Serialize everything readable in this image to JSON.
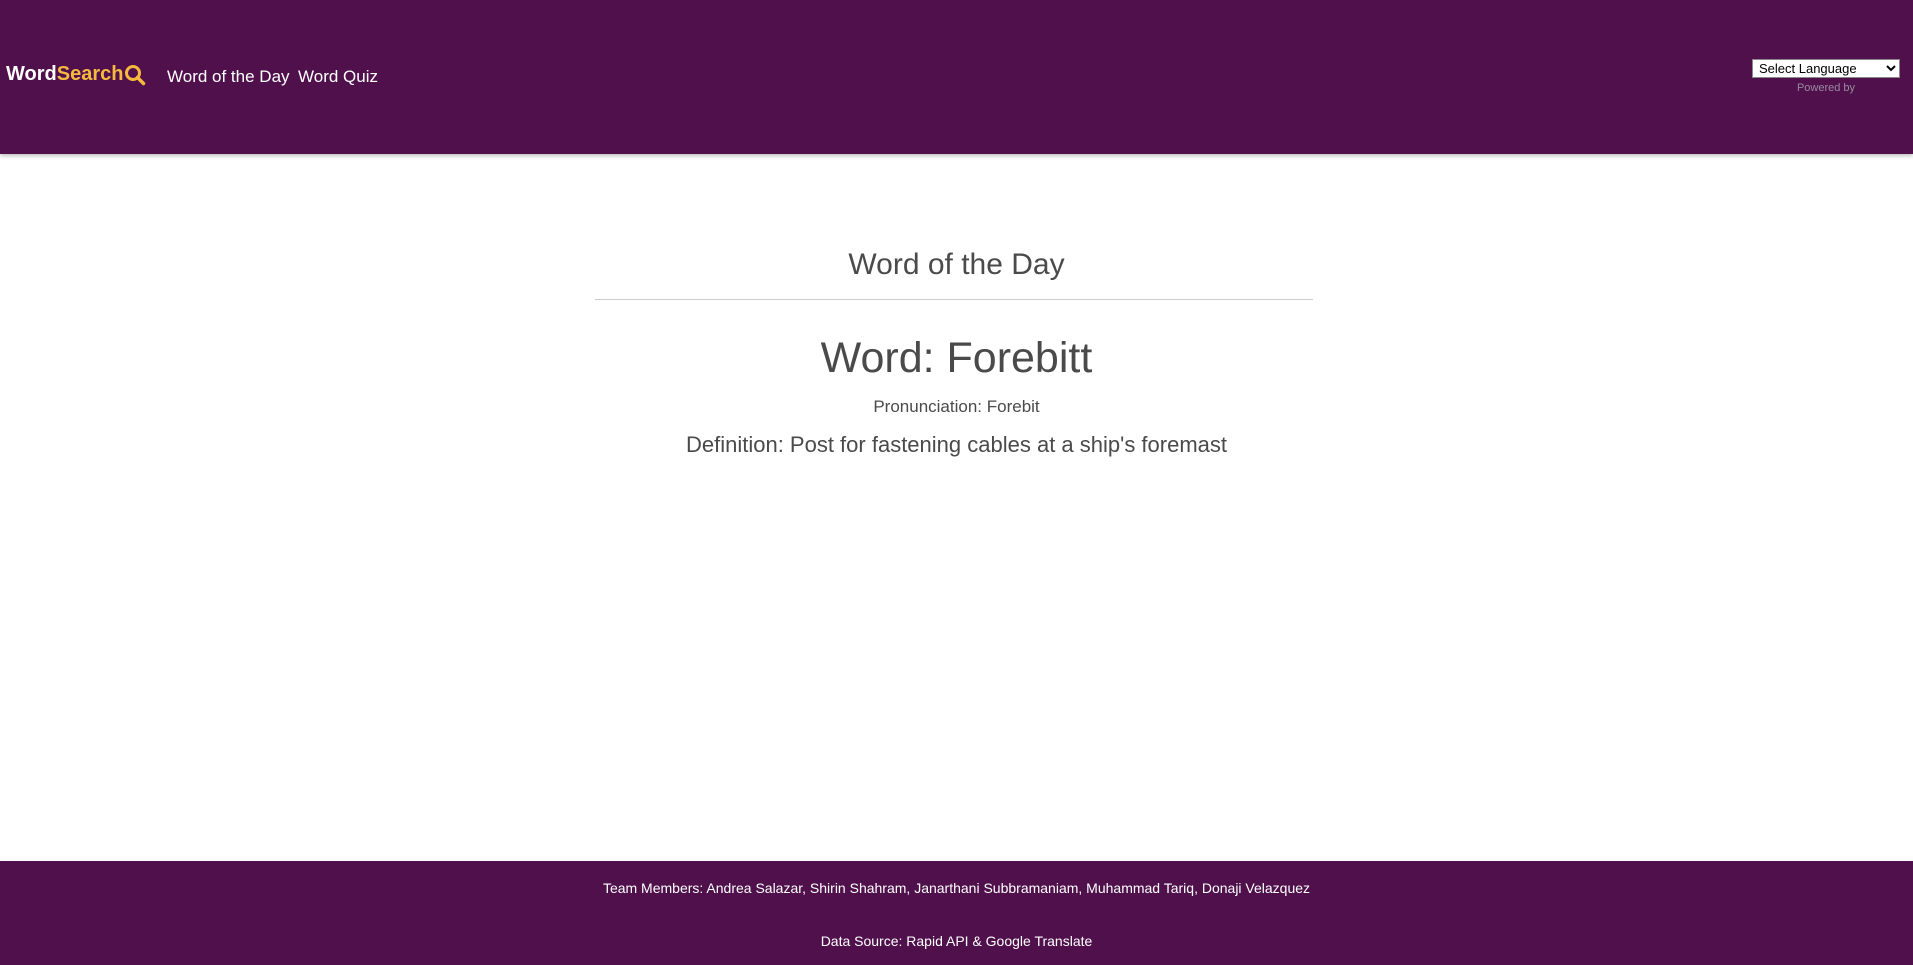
{
  "header": {
    "brand": {
      "part1": "Word",
      "part2": "Search",
      "icon": "search-icon"
    },
    "nav": [
      {
        "label": "Word of the Day"
      },
      {
        "label": "Word Quiz"
      }
    ],
    "language": {
      "selected": "Select Language",
      "powered_by": "Powered by"
    }
  },
  "main": {
    "section_title": "Word of the Day",
    "word": "Word: Forebitt",
    "pronunciation": "Pronunciation: Forebit",
    "definition": "Definition: Post for fastening cables at a ship's foremast"
  },
  "footer": {
    "team": "Team Members: Andrea Salazar, Shirin Shahram, Janarthani Subbramaniam, Muhammad Tariq, Donaji Velazquez",
    "source": "Data Source: Rapid API & Google Translate"
  },
  "colors": {
    "header_bg": "#4f104c",
    "brand_accent": "#f5b93f",
    "text": "#4a4a4a"
  }
}
